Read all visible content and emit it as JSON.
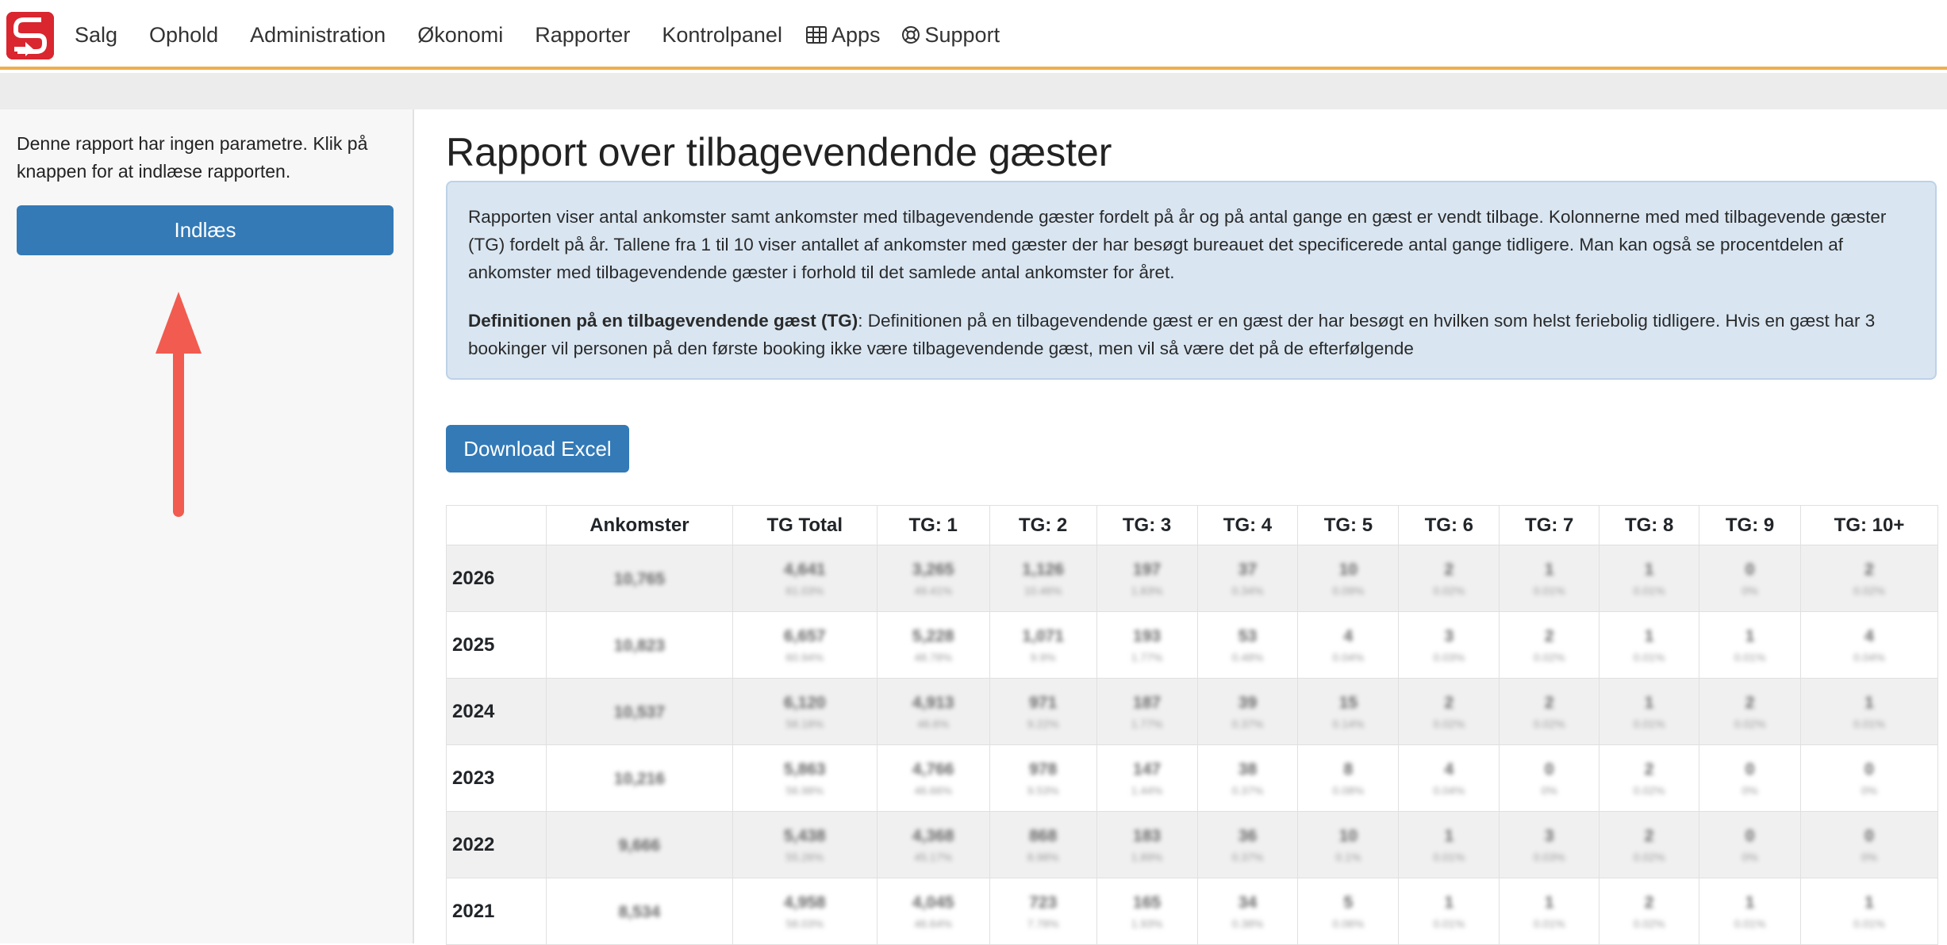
{
  "nav": {
    "items": [
      "Salg",
      "Ophold",
      "Administration",
      "Økonomi",
      "Rapporter",
      "Kontrolpanel"
    ],
    "apps_label": "Apps",
    "support_label": "Support"
  },
  "sidebar": {
    "text": "Denne rapport har ingen parametre. Klik på knappen for at indlæse rapporten.",
    "load_button": "Indlæs"
  },
  "main": {
    "title": "Rapport over tilbagevendende gæster",
    "info_paragraph": "Rapporten viser antal ankomster samt ankomster med tilbagevendende gæster fordelt på år og på antal gange en gæst er vendt tilbage. Kolonnerne med med tilbagevende gæster (TG) fordelt på år. Tallene fra 1 til 10 viser antallet af ankomster med gæster der har besøgt bureauet det specificerede antal gange tidligere. Man kan også se procentdelen af ankomster med tilbagevendende gæster i forhold til det samlede antal ankomster for året.",
    "definition_title": "Definitionen på en tilbagevendende gæst (TG)",
    "definition_text": ": Definitionen på en tilbagevendende gæst er en gæst der har besøgt en hvilken som helst feriebolig tidligere. Hvis en gæst har 3 bookinger vil personen på den første booking ikke være tilbagevendende gæst, men vil så være det på de efterfølgende",
    "excel_button": "Download Excel"
  },
  "table": {
    "headers": [
      "",
      "Ankomster",
      "TG Total",
      "TG: 1",
      "TG: 2",
      "TG: 3",
      "TG: 4",
      "TG: 5",
      "TG: 6",
      "TG: 7",
      "TG: 8",
      "TG: 9",
      "TG: 10+"
    ],
    "rows": [
      {
        "year": "2026",
        "ankomster": "10,765",
        "cells": [
          [
            "4,641",
            "61.03%"
          ],
          [
            "3,265",
            "49.41%"
          ],
          [
            "1,126",
            "10.46%"
          ],
          [
            "197",
            "1.83%"
          ],
          [
            "37",
            "0.34%"
          ],
          [
            "10",
            "0.09%"
          ],
          [
            "2",
            "0.02%"
          ],
          [
            "1",
            "0.01%"
          ],
          [
            "1",
            "0.01%"
          ],
          [
            "0",
            "0%"
          ],
          [
            "2",
            "0.02%"
          ]
        ]
      },
      {
        "year": "2025",
        "ankomster": "10,823",
        "cells": [
          [
            "6,657",
            "60.94%"
          ],
          [
            "5,228",
            "48.78%"
          ],
          [
            "1,071",
            "9.9%"
          ],
          [
            "193",
            "1.77%"
          ],
          [
            "53",
            "0.48%"
          ],
          [
            "4",
            "0.04%"
          ],
          [
            "3",
            "0.03%"
          ],
          [
            "2",
            "0.02%"
          ],
          [
            "1",
            "0.01%"
          ],
          [
            "1",
            "0.01%"
          ],
          [
            "4",
            "0.04%"
          ]
        ]
      },
      {
        "year": "2024",
        "ankomster": "10,537",
        "cells": [
          [
            "6,120",
            "58.18%"
          ],
          [
            "4,913",
            "46.6%"
          ],
          [
            "971",
            "9.22%"
          ],
          [
            "187",
            "1.77%"
          ],
          [
            "39",
            "0.37%"
          ],
          [
            "15",
            "0.14%"
          ],
          [
            "2",
            "0.02%"
          ],
          [
            "2",
            "0.02%"
          ],
          [
            "1",
            "0.01%"
          ],
          [
            "2",
            "0.02%"
          ],
          [
            "1",
            "0.01%"
          ]
        ]
      },
      {
        "year": "2023",
        "ankomster": "10,216",
        "cells": [
          [
            "5,863",
            "56.98%"
          ],
          [
            "4,766",
            "46.66%"
          ],
          [
            "978",
            "9.53%"
          ],
          [
            "147",
            "1.44%"
          ],
          [
            "38",
            "0.37%"
          ],
          [
            "8",
            "0.08%"
          ],
          [
            "4",
            "0.04%"
          ],
          [
            "0",
            "0%"
          ],
          [
            "2",
            "0.02%"
          ],
          [
            "0",
            "0%"
          ],
          [
            "0",
            "0%"
          ]
        ]
      },
      {
        "year": "2022",
        "ankomster": "9,666",
        "cells": [
          [
            "5,438",
            "55.26%"
          ],
          [
            "4,368",
            "45.17%"
          ],
          [
            "868",
            "8.98%"
          ],
          [
            "183",
            "1.89%"
          ],
          [
            "36",
            "0.37%"
          ],
          [
            "10",
            "0.1%"
          ],
          [
            "1",
            "0.01%"
          ],
          [
            "3",
            "0.03%"
          ],
          [
            "2",
            "0.02%"
          ],
          [
            "0",
            "0%"
          ],
          [
            "0",
            "0%"
          ]
        ]
      },
      {
        "year": "2021",
        "ankomster": "8,534",
        "cells": [
          [
            "4,958",
            "58.03%"
          ],
          [
            "4,045",
            "46.64%"
          ],
          [
            "723",
            "7.78%"
          ],
          [
            "165",
            "1.93%"
          ],
          [
            "34",
            "0.38%"
          ],
          [
            "5",
            "0.06%"
          ],
          [
            "1",
            "0.01%"
          ],
          [
            "1",
            "0.01%"
          ],
          [
            "2",
            "0.02%"
          ],
          [
            "1",
            "0.01%"
          ],
          [
            "1",
            "0.01%"
          ]
        ]
      }
    ]
  },
  "colors": {
    "accent": "#337ab7",
    "navbar_border": "#f0ad4e",
    "logo": "#d9262f",
    "arrow": "#f25b4f",
    "info_bg": "#d9e6f2"
  }
}
